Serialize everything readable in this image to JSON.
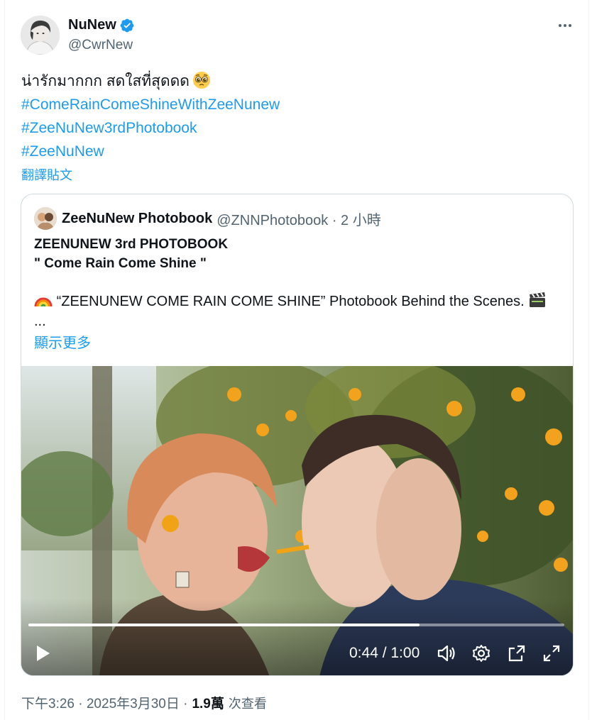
{
  "author": {
    "display_name": "NuNew",
    "handle": "@CwrNew",
    "verified": true
  },
  "tweet": {
    "text_line": "น่ารักมากกก สดใสที่สุดดด",
    "emoji": "pleading-face-icon",
    "hashtags": [
      "#ComeRainComeShineWithZeeNunew",
      "#ZeeNuNew3rdPhotobook",
      "#ZeeNuNew"
    ],
    "translate_label": "翻譯貼文"
  },
  "quote": {
    "display_name": "ZeeNuNew Photobook",
    "meta": "@ZNNPhotobook · 2 小時",
    "title_lines": [
      "ZEENUNEW 3rd PHOTOBOOK",
      "\" Come Rain Come Shine \""
    ],
    "desc_line": "“ZEENUNEW COME RAIN COME SHINE” Photobook Behind the Scenes.",
    "ellipsis": "...",
    "show_more": "顯示更多",
    "video": {
      "time": "0:44 / 1:00",
      "progress": 0.73
    }
  },
  "footer": {
    "timestamp": "下午3:26 · 2025年3月30日 ·",
    "views": "1.9萬",
    "views_label": "次查看"
  },
  "colors": {
    "link": "#1d9bf0",
    "secondary_text": "#536471",
    "border": "#cfd9de",
    "verified": "#1d9bf0"
  }
}
